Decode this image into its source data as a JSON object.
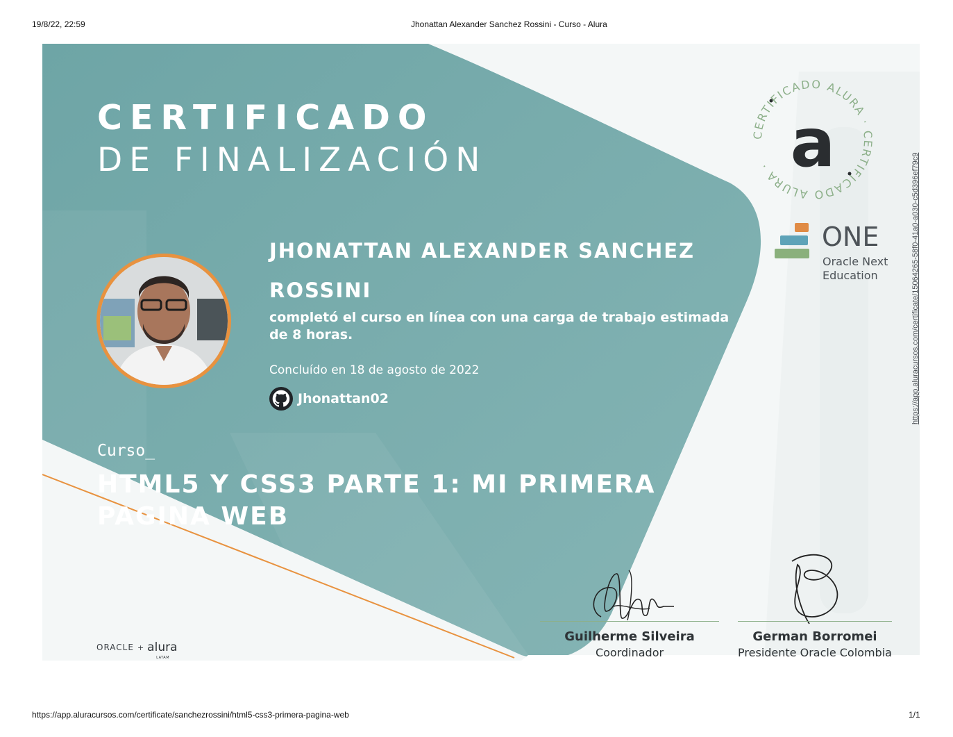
{
  "browser": {
    "timestamp": "19/8/22, 22:59",
    "page_title": "Jhonattan Alexander Sanchez Rossini - Curso - Alura",
    "footer_url": "https://app.aluracursos.com/certificate/sanchezrossini/html5-css3-primera-pagina-web",
    "page_count": "1/1"
  },
  "certificate": {
    "title": "CERTIFICADO",
    "subtitle": "DE FINALIZACIÓN",
    "student_name": "JHONATTAN ALEXANDER SANCHEZ ROSSINI",
    "completed_text": "completó el curso en línea con una carga de trabajo estimada de 8 horas.",
    "concluded_text": "Concluído en 18 de agosto de 2022",
    "github_user": "Jhonattan02",
    "course_label": "Curso_",
    "course_name": "HTML5 Y CSS3 PARTE 1: MI PRIMERA PAGINA WEB",
    "seal_text": "CERTIFICADO ALURA · CERTIFICADO ALURA ·",
    "seal_letter": "a",
    "one_title": "ONE",
    "one_subtitle_line1": "Oracle Next",
    "one_subtitle_line2": "Education",
    "verify_url": "https://app.aluracursos.com/certificate/15064265-58f0-41a0-a030-c5d396ef79c9",
    "partners": {
      "oracle": "ORACLE",
      "plus": "+",
      "alura": "alura",
      "latam": "LATAM"
    },
    "signatures": [
      {
        "name": "Guilherme Silveira",
        "role": "Coordinador"
      },
      {
        "name": "German Borromei",
        "role": "Presidente Oracle Colombia"
      }
    ]
  },
  "colors": {
    "teal": "#7fb0b1",
    "teal_dark": "#6fa6a7",
    "accent_orange": "#e8923f",
    "seal_green": "#8db08a"
  },
  "icons": [
    "github-icon",
    "alura-seal-icon",
    "one-logo-icon"
  ]
}
